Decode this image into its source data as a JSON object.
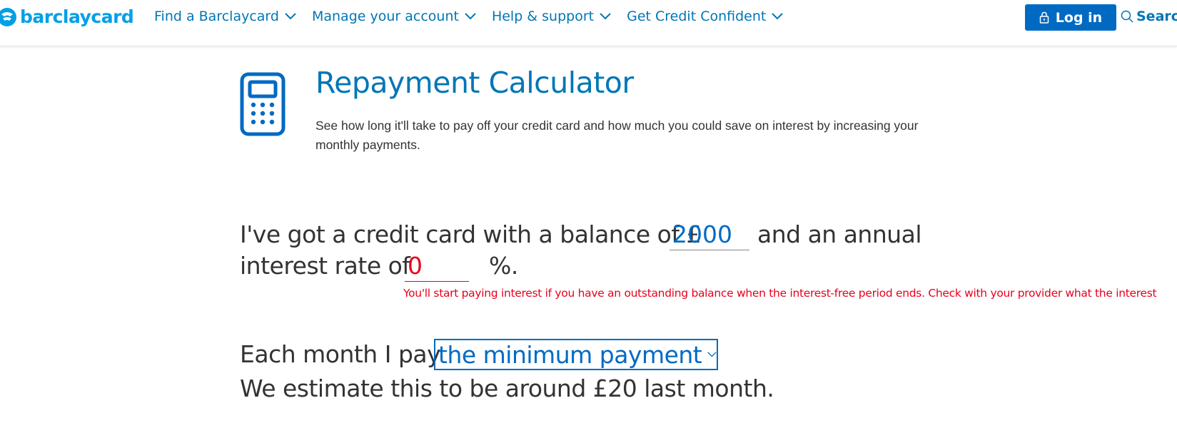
{
  "header": {
    "logo_text": "barclaycard",
    "nav": [
      {
        "label": "Find a Barclaycard"
      },
      {
        "label": "Manage your account"
      },
      {
        "label": "Help & support"
      },
      {
        "label": "Get Credit Confident"
      }
    ],
    "login_label": "Log in",
    "search_label": "Search"
  },
  "calculator": {
    "title": "Repayment Calculator",
    "intro": "See how long it'll take to pay off your credit card and how much you could save on interest by increasing your monthly payments.",
    "sentence_1a": "I've got a credit card with a balance of £",
    "balance_value": "2000",
    "sentence_1b": "and an annual",
    "sentence_2a": "interest rate of",
    "rate_value": "0",
    "sentence_2b": "%.",
    "error_message": "You'll start paying interest if you have an outstanding balance when the interest-free period ends. Check with your provider what the interest",
    "sentence_3": "Each month I pay",
    "payment_option": "the minimum payment",
    "estimate": "We estimate this to be around £20 last month."
  },
  "colors": {
    "brand_blue": "#006ac3",
    "link_blue": "#0076b6",
    "logo_cyan": "#00a0e6",
    "error_red": "#e8001c"
  },
  "icons": [
    "barclaycard-logo-icon",
    "chevron-down-icon",
    "lock-icon",
    "search-icon",
    "calculator-icon"
  ]
}
